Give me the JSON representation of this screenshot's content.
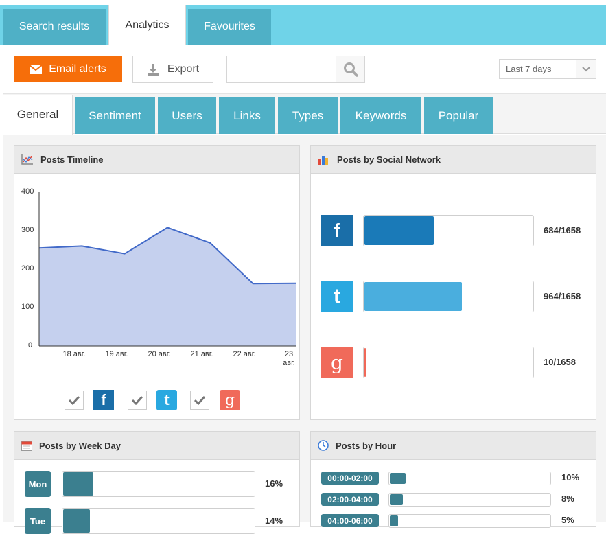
{
  "top_tabs": [
    {
      "label": "Search results",
      "active": false
    },
    {
      "label": "Analytics",
      "active": true
    },
    {
      "label": "Favourites",
      "active": false
    }
  ],
  "toolbar": {
    "email_alerts_label": "Email alerts",
    "export_label": "Export",
    "search_value": "",
    "date_range_selected": "Last 7 days"
  },
  "sub_tabs": [
    {
      "label": "General",
      "active": true
    },
    {
      "label": "Sentiment",
      "active": false
    },
    {
      "label": "Users",
      "active": false
    },
    {
      "label": "Links",
      "active": false
    },
    {
      "label": "Types",
      "active": false
    },
    {
      "label": "Keywords",
      "active": false
    },
    {
      "label": "Popular",
      "active": false
    }
  ],
  "panels": {
    "timeline_title": "Posts Timeline",
    "social_title": "Posts by Social Network",
    "weekday_title": "Posts by Week Day",
    "hour_title": "Posts by Hour"
  },
  "chart_data": {
    "type": "area",
    "x": [
      "",
      "18 авг.",
      "19 авг.",
      "20 авг.",
      "21 авг.",
      "22 авг.",
      "23 авг."
    ],
    "values": [
      255,
      260,
      240,
      308,
      268,
      162,
      163
    ],
    "y_ticks": [
      "0",
      "100",
      "200",
      "300",
      "400"
    ],
    "ylim": [
      0,
      400
    ],
    "color": "#c5d0ee",
    "line_color": "#4169c8"
  },
  "timeline_legend": [
    {
      "network": "facebook",
      "checked": true
    },
    {
      "network": "twitter",
      "checked": true
    },
    {
      "network": "google",
      "checked": true
    }
  ],
  "social_networks": [
    {
      "name": "facebook",
      "count_label": "684/1658",
      "fraction": 0.4125,
      "color": "#1a7ab8",
      "icon_bg": "#1a6ea8"
    },
    {
      "name": "twitter",
      "count_label": "964/1658",
      "fraction": 0.5814,
      "color": "#4aaede",
      "icon_bg": "#29a8e0"
    },
    {
      "name": "google",
      "count_label": "10/1658",
      "fraction": 0.006,
      "color": "#f06858",
      "icon_bg": "#f06a5a"
    }
  ],
  "week_days": [
    {
      "day": "Mon",
      "pct_label": "16%",
      "fraction": 0.16
    },
    {
      "day": "Tue",
      "pct_label": "14%",
      "fraction": 0.14
    }
  ],
  "hours": [
    {
      "range": "00:00-02:00",
      "pct_label": "10%",
      "fraction": 0.1
    },
    {
      "range": "02:00-04:00",
      "pct_label": "8%",
      "fraction": 0.08
    },
    {
      "range": "04:00-06:00",
      "pct_label": "5%",
      "fraction": 0.05
    }
  ]
}
